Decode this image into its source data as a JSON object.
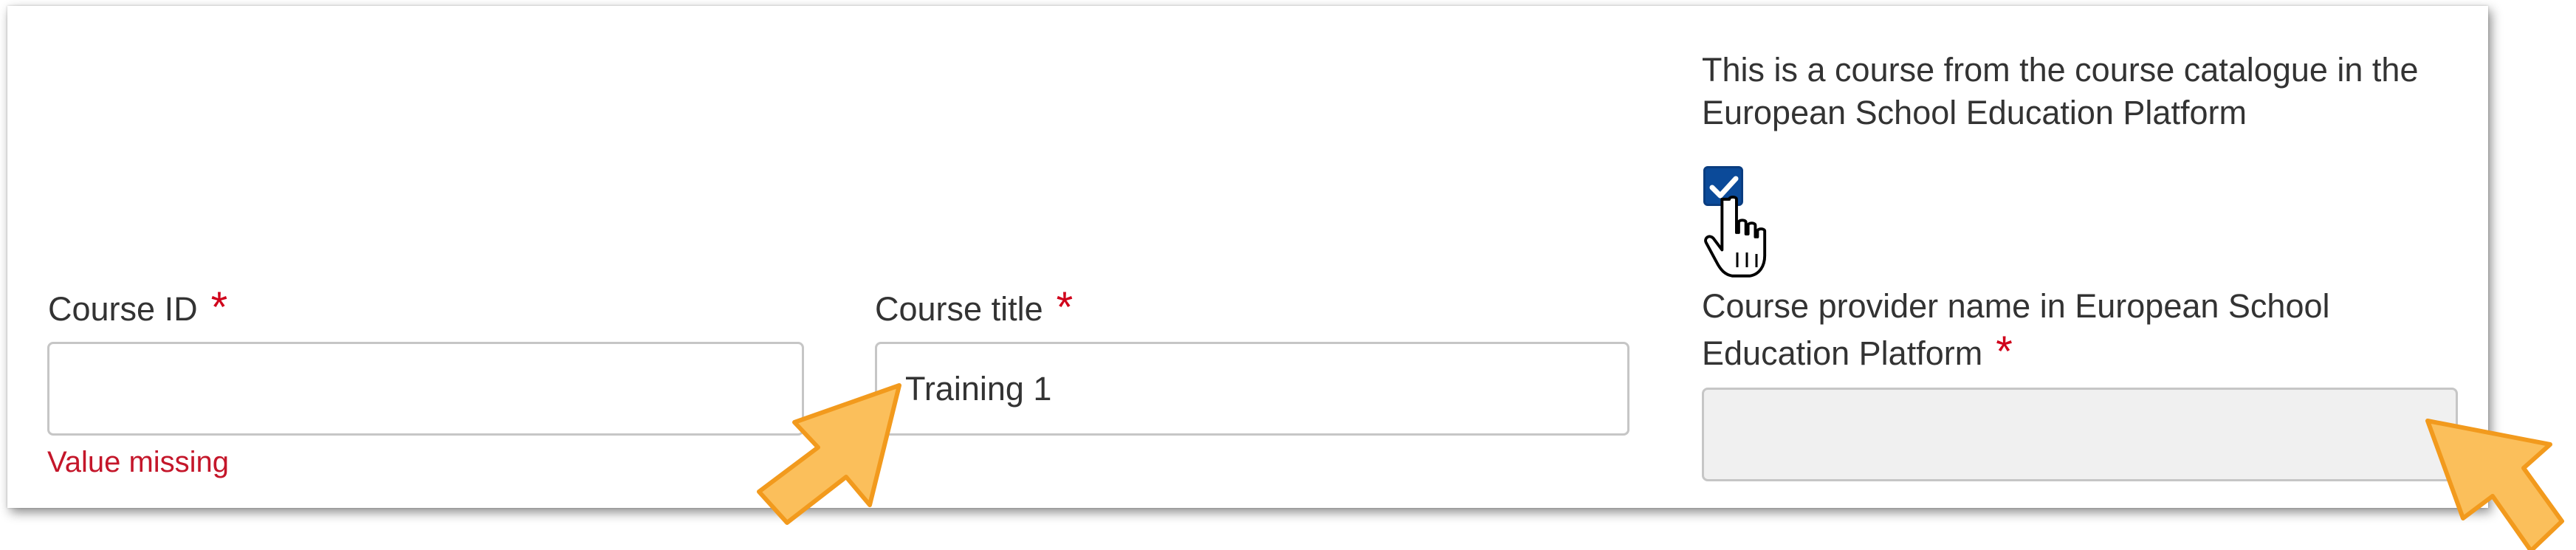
{
  "fields": {
    "course_id": {
      "label": "Course ID",
      "required_mark": "*",
      "value": "",
      "error": "Value missing"
    },
    "course_title": {
      "label": "Course title",
      "required_mark": "*",
      "value": "Training 1"
    },
    "catalogue": {
      "text": "This is a course from the course catalogue in the European School Education Platform",
      "checked": true
    },
    "provider_name": {
      "label_line1": "Course provider name in European School",
      "label_line2": "Education Platform",
      "required_mark": "*",
      "value": ""
    }
  },
  "icons": {
    "checkbox_check": "check-icon",
    "pointer": "hand-pointer-icon",
    "callout": "arrow-callout-icon"
  },
  "colors": {
    "required": "#d0021b",
    "error": "#c4162a",
    "checkbox": "#0b4a99",
    "callout_arrow": "#fbbf5b",
    "callout_arrow_border": "#f29a1d"
  }
}
